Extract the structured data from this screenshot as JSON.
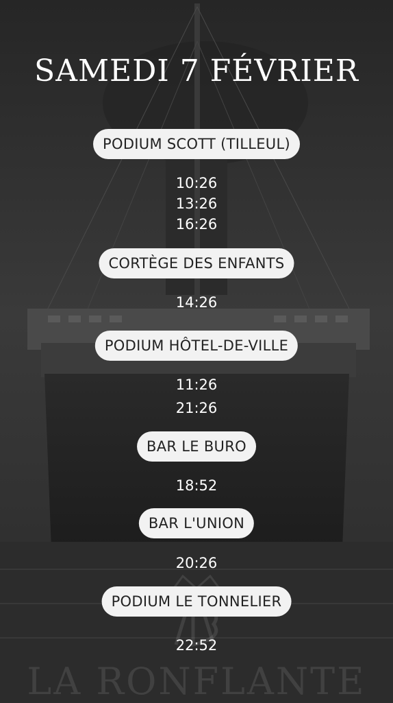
{
  "title": "SAMEDI 7 FÉVRIER",
  "venues": [
    {
      "name": "PODIUM SCOTT (TILLEUL)",
      "times": [
        "10:26",
        "13:26",
        "16:26"
      ]
    },
    {
      "name": "CORTÈGE DES ENFANTS",
      "times": [
        "14:26"
      ]
    },
    {
      "name": "PODIUM HÔTEL-DE-VILLE",
      "times": [
        "11:26",
        "21:26"
      ]
    },
    {
      "name": "BAR LE BURO",
      "times": [
        "18:52"
      ]
    },
    {
      "name": "BAR L'UNION",
      "times": [
        "20:26"
      ]
    },
    {
      "name": "PODIUM LE TONNELIER",
      "times": [
        "22:52"
      ]
    }
  ],
  "brand": "LA RONFLANTE"
}
